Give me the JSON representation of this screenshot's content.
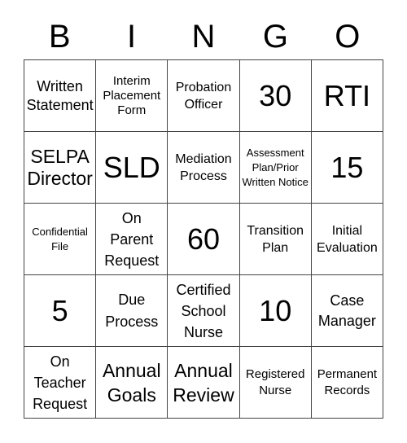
{
  "header": {
    "letters": [
      "B",
      "I",
      "N",
      "G",
      "O"
    ]
  },
  "board": {
    "rows": [
      [
        "Written Statement",
        "Interim Placement Form",
        "Probation Officer",
        "30",
        "RTI"
      ],
      [
        "SELPA Director",
        "SLD",
        "Mediation Process",
        "Assessment Plan/Prior Written Notice",
        "15"
      ],
      [
        "Confidential File",
        "On Parent Request",
        "60",
        "Transition Plan",
        "Initial Evaluation"
      ],
      [
        "5",
        "Due Process",
        "Certified School Nurse",
        "10",
        "Case Manager"
      ],
      [
        "On Teacher Request",
        "Annual Goals",
        "Annual Review",
        "Registered Nurse",
        "Permanent Records"
      ]
    ]
  },
  "colors": {
    "grid_line": "#444444",
    "text": "#000000",
    "background": "#ffffff"
  }
}
